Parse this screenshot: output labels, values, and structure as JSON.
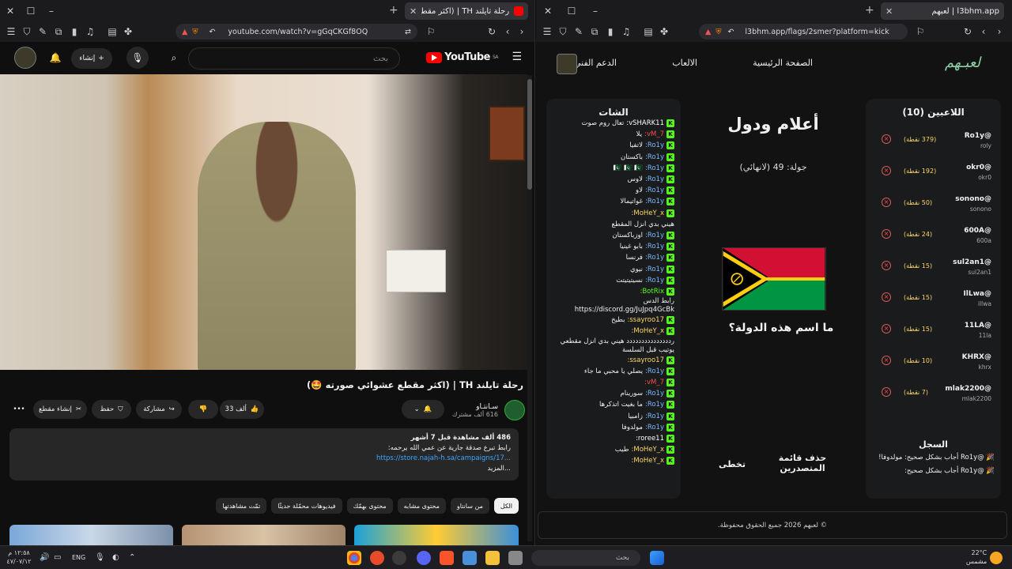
{
  "left_window": {
    "tab_title": "رحلة تايلند TH | (اكثر مقطع عش...",
    "url": "youtube.com/watch?v=gGqCKGf8OQ",
    "search_placeholder": "بحث",
    "create_label": "إنشاء",
    "brand": "YouTube",
    "country_code": "SA",
    "video_title": "رحلة تايلند TH | (اكثر مقطع عشوائي صورته 🤩)",
    "channel_name": "سـانتـاو",
    "channel_subs": "616 ألف مشترك",
    "likes": "33 ألف",
    "share_label": "مشاركة",
    "save_label": "حفظ",
    "clip_label": "إنشاء مقطع",
    "description": {
      "line1": "486 ألف مشاهدة قبل 7 أشهر",
      "line2": "رابط تبرع صدقة جارية عن عمي الله يرحمه:",
      "link": "https://store.najah-h.sa/campaigns/17...",
      "more": "...المزيد"
    },
    "chips": [
      "الكل",
      "من سانتاو",
      "محتوى مشابه",
      "محتوى بهمّك",
      "فيديوهات محمّلة حديثًا",
      "تمّت مشاهدتها"
    ]
  },
  "right_window": {
    "tab_title": "لعبهم | l3bhm.app",
    "url": "l3bhm.app/flags/2smer?platform=kick",
    "logo": "لعبـهم",
    "nav": [
      "الصفحة الرئيسية",
      "الالعاب",
      "الدعم الفني"
    ],
    "chat_title": "الشات",
    "chat": [
      {
        "user": "vSHARK11:",
        "msg": "تعال روم صوت",
        "color": "#ffffff"
      },
      {
        "user": "vM_7:",
        "msg": "يلا",
        "color": "#ff4d4d"
      },
      {
        "user": "Ro1y:",
        "msg": "لاتفيا",
        "color": "#7ab8ff"
      },
      {
        "user": "Ro1y:",
        "msg": "باكستان",
        "color": "#7ab8ff"
      },
      {
        "user": "Ro1y:",
        "msg": "🇵🇰 🇵🇰 🇵🇰",
        "color": "#7ab8ff"
      },
      {
        "user": "Ro1y:",
        "msg": "لاوس",
        "color": "#7ab8ff"
      },
      {
        "user": "Ro1y:",
        "msg": "لاو",
        "color": "#7ab8ff"
      },
      {
        "user": "Ro1y:",
        "msg": "غواتيمالا",
        "color": "#7ab8ff"
      },
      {
        "user": "MoHeY_x:",
        "msg": "",
        "color": "#ffd866"
      },
      {
        "user": "",
        "msg": "هيني بدي انزل المقطع",
        "color": "#ffffff"
      },
      {
        "user": "Ro1y:",
        "msg": "اوزباكستان",
        "color": "#7ab8ff"
      },
      {
        "user": "Ro1y:",
        "msg": "بابو غينيا",
        "color": "#7ab8ff"
      },
      {
        "user": "Ro1y:",
        "msg": "فرنسا",
        "color": "#7ab8ff"
      },
      {
        "user": "Ro1y:",
        "msg": "نيوي",
        "color": "#7ab8ff"
      },
      {
        "user": "Ro1y:",
        "msg": "نسيتيتيتت",
        "color": "#7ab8ff"
      },
      {
        "user": "BotRix:",
        "msg": "",
        "color": "#53fc18"
      }
    ],
    "chat_block": "رابط الدس https://discord.gg/JuJpq4GcBk",
    "chat2": [
      {
        "user": "ssayroo17:",
        "msg": "بطيخ",
        "color": "#ffd866"
      },
      {
        "user": "MoHeY_x:",
        "msg": "",
        "color": "#ffd866"
      }
    ],
    "chat_block2": "رددددددددددددددد هيني بدي انزل مقطعي يوتيب قبل السلسة",
    "chat3": [
      {
        "user": "ssayroo17:",
        "msg": "",
        "color": "#ffd866"
      },
      {
        "user": "Ro1y:",
        "msg": "يصلي يا محبي ما جاء",
        "color": "#7ab8ff"
      },
      {
        "user": "vM_7:",
        "msg": "",
        "color": "#ff4d4d"
      },
      {
        "user": "Ro1y:",
        "msg": "سورينام",
        "color": "#7ab8ff"
      },
      {
        "user": "Ro1y:",
        "msg": "ما بغيت اتذكرها",
        "color": "#7ab8ff"
      },
      {
        "user": "Ro1y:",
        "msg": "زامبيا",
        "color": "#7ab8ff"
      },
      {
        "user": "Ro1y:",
        "msg": "مولدوفا",
        "color": "#7ab8ff"
      },
      {
        "user": "roree11:",
        "msg": "",
        "color": "#ffffff"
      },
      {
        "user": "MoHeY_x:",
        "msg": "طيب",
        "color": "#ffd866"
      },
      {
        "user": "MoHeY_x:",
        "msg": "",
        "color": "#ffd866"
      }
    ],
    "game_title": "أعلام ودول",
    "round": "جولة: 49 (لانهائي)",
    "question": "ما اسم هذه الدولة؟",
    "players_title": "اللاعبين (10)",
    "players": [
      {
        "name": "@Ro1y",
        "handle": "roly",
        "points": "(379 نقطة)"
      },
      {
        "name": "@okr0",
        "handle": "okr0",
        "points": "(192 نقطة)"
      },
      {
        "name": "@sonono",
        "handle": "sonono",
        "points": "(50 نقطة)"
      },
      {
        "name": "@600A",
        "handle": "600a",
        "points": "(24 نقطة)"
      },
      {
        "name": "@sul2an1",
        "handle": "sul2an1",
        "points": "(15 نقطة)"
      },
      {
        "name": "@IlLwa",
        "handle": "illwa",
        "points": "(15 نقطة)"
      },
      {
        "name": "@11LA",
        "handle": "11la",
        "points": "(15 نقطة)"
      },
      {
        "name": "@KHRX",
        "handle": "khrx",
        "points": "(10 نقطة)"
      },
      {
        "name": "@mlak2200",
        "handle": "mlak2200",
        "points": "(7 نقطة)"
      }
    ],
    "log_title": "السجل",
    "log": [
      "🎉 @Ro1y أجاب بشكل صحيح: مولدوفا!",
      "🎉 @Ro1y أجاب بشكل صحيح:"
    ],
    "leaderboard_label": "حذف قائمة المتصدرين",
    "skip_label": "تخطى",
    "footer": "© لعبهم 2026 جميع الحقوق محفوظة."
  },
  "taskbar": {
    "search": "بحث",
    "lang": "ENG",
    "time": "١٢:٥٨ م",
    "date": "٤٧/٠٧/١٢",
    "weather_temp": "22°C",
    "weather_desc": "مشمس"
  }
}
